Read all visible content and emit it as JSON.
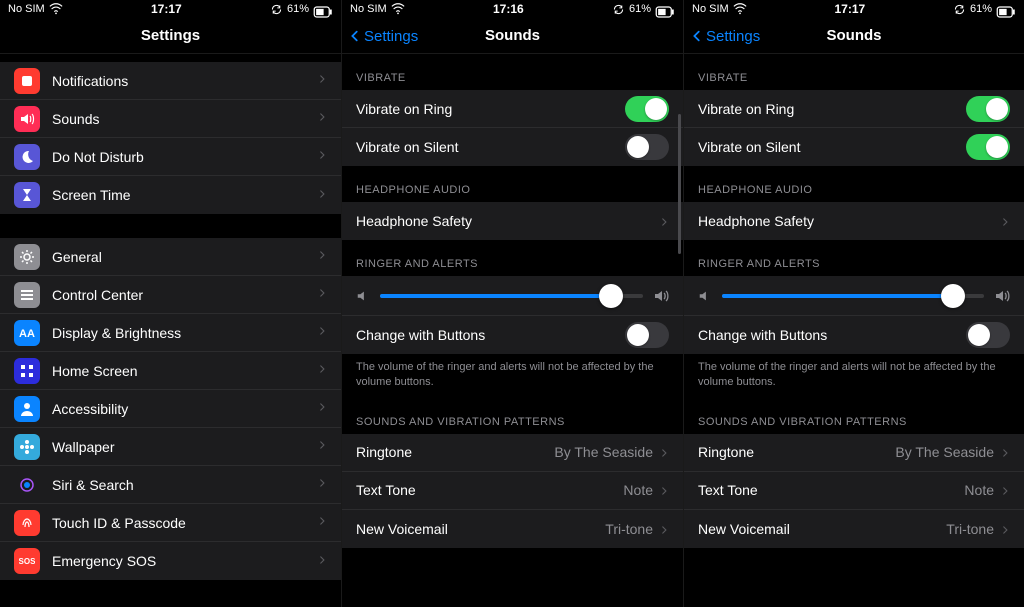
{
  "statusbar": {
    "carrier": "No SIM",
    "battery": "61%"
  },
  "screens": [
    {
      "time": "17:17",
      "title": "Settings",
      "back": null,
      "groups": [
        {
          "header": null,
          "rows": [
            {
              "label": "Notifications",
              "icon": "notifications",
              "bg": "#ff3b30"
            },
            {
              "label": "Sounds",
              "icon": "speaker",
              "bg": "#ff2d55"
            },
            {
              "label": "Do Not Disturb",
              "icon": "moon",
              "bg": "#5856d6"
            },
            {
              "label": "Screen Time",
              "icon": "hourglass",
              "bg": "#5856d6"
            }
          ]
        },
        {
          "header": null,
          "rows": [
            {
              "label": "General",
              "icon": "gear",
              "bg": "#8e8e93"
            },
            {
              "label": "Control Center",
              "icon": "sliders",
              "bg": "#8e8e93"
            },
            {
              "label": "Display & Brightness",
              "icon": "letter-a",
              "bg": "#0a84ff"
            },
            {
              "label": "Home Screen",
              "icon": "grid",
              "bg": "#2c2cdc"
            },
            {
              "label": "Accessibility",
              "icon": "person",
              "bg": "#0a84ff"
            },
            {
              "label": "Wallpaper",
              "icon": "flower",
              "bg": "#34aadc"
            },
            {
              "label": "Siri & Search",
              "icon": "siri",
              "bg": "#1c1c1e"
            },
            {
              "label": "Touch ID & Passcode",
              "icon": "fingerprint",
              "bg": "#ff3b30"
            },
            {
              "label": "Emergency SOS",
              "icon": "sos-text",
              "bg": "#ff3b30"
            }
          ]
        }
      ]
    },
    {
      "time": "17:16",
      "title": "Sounds",
      "back": "Settings",
      "sections": [
        {
          "header": "VIBRATE",
          "rows": [
            {
              "label": "Vibrate on Ring",
              "toggle": true
            },
            {
              "label": "Vibrate on Silent",
              "toggle": false
            }
          ]
        },
        {
          "header": "HEADPHONE AUDIO",
          "rows": [
            {
              "label": "Headphone Safety",
              "chevron": true
            }
          ]
        },
        {
          "header": "RINGER AND ALERTS",
          "slider": 0.88,
          "rows": [
            {
              "label": "Change with Buttons",
              "toggle": false
            }
          ],
          "footer": "The volume of the ringer and alerts will not be affected by the volume buttons."
        },
        {
          "header": "SOUNDS AND VIBRATION PATTERNS",
          "rows": [
            {
              "label": "Ringtone",
              "value": "By The Seaside",
              "chevron": true
            },
            {
              "label": "Text Tone",
              "value": "Note",
              "chevron": true
            },
            {
              "label": "New Voicemail",
              "value": "Tri-tone",
              "chevron": true
            }
          ]
        }
      ],
      "scrollbar": true
    },
    {
      "time": "17:17",
      "title": "Sounds",
      "back": "Settings",
      "sections": [
        {
          "header": "VIBRATE",
          "rows": [
            {
              "label": "Vibrate on Ring",
              "toggle": true
            },
            {
              "label": "Vibrate on Silent",
              "toggle": true
            }
          ]
        },
        {
          "header": "HEADPHONE AUDIO",
          "rows": [
            {
              "label": "Headphone Safety",
              "chevron": true
            }
          ]
        },
        {
          "header": "RINGER AND ALERTS",
          "slider": 0.88,
          "rows": [
            {
              "label": "Change with Buttons",
              "toggle": false
            }
          ],
          "footer": "The volume of the ringer and alerts will not be affected by the volume buttons."
        },
        {
          "header": "SOUNDS AND VIBRATION PATTERNS",
          "rows": [
            {
              "label": "Ringtone",
              "value": "By The Seaside",
              "chevron": true
            },
            {
              "label": "Text Tone",
              "value": "Note",
              "chevron": true
            },
            {
              "label": "New Voicemail",
              "value": "Tri-tone",
              "chevron": true
            }
          ]
        }
      ],
      "scrollbar": false
    }
  ]
}
